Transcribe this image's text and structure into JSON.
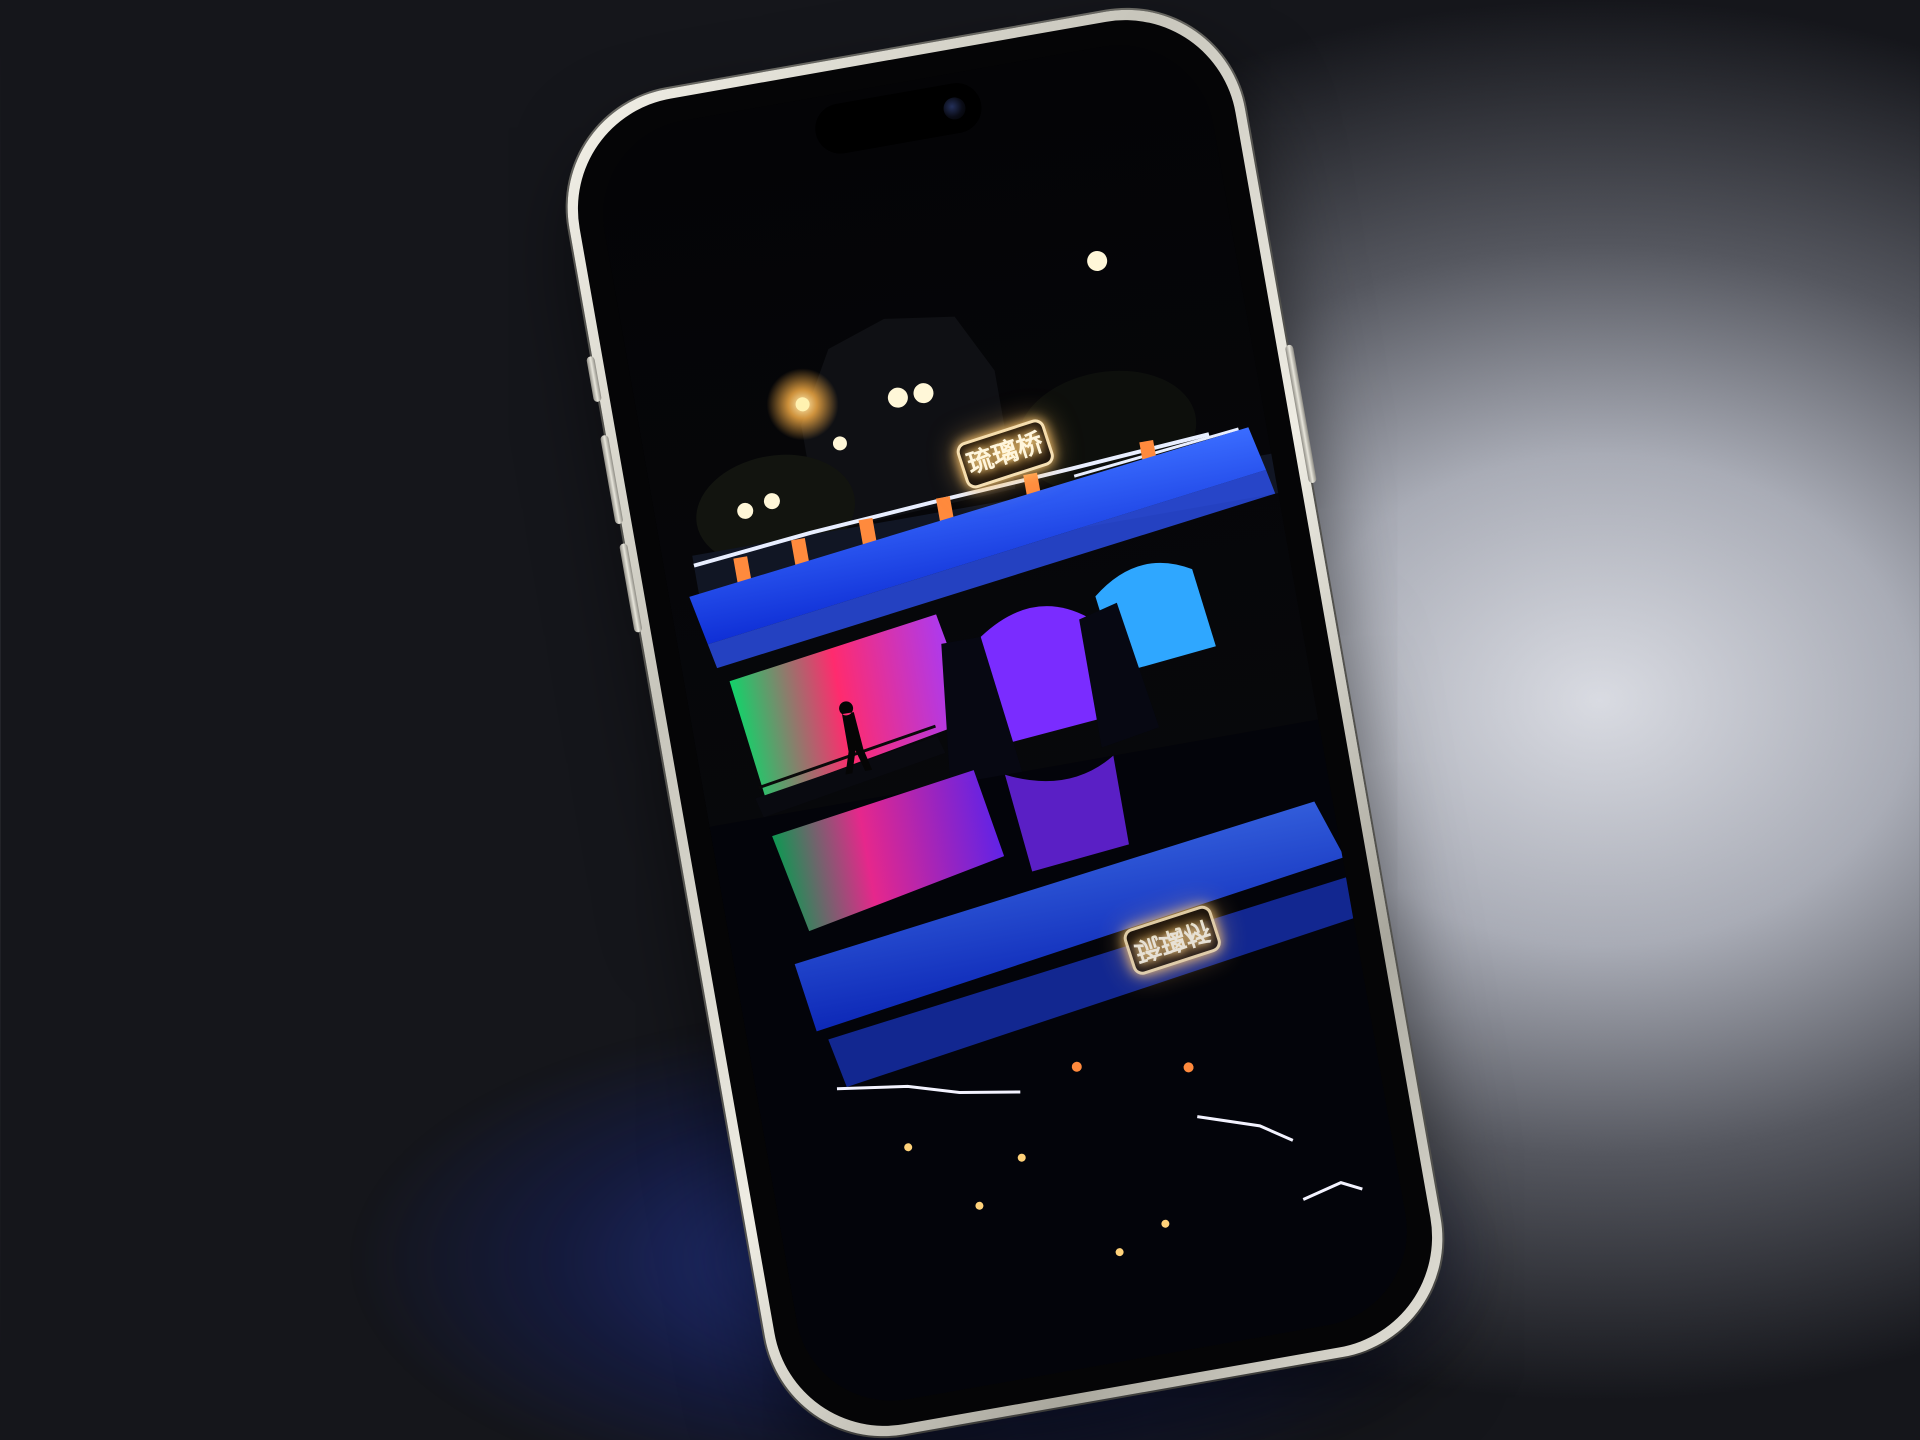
{
  "image": {
    "description_tags": [
      "smartphone",
      "night-photo",
      "illuminated-bridge",
      "reflection"
    ]
  },
  "phone": {
    "frame_color": "#e9e7de",
    "screen_photo": {
      "sign_text": "琉璃桥",
      "sign_reflection_text": "琉璃桥"
    }
  },
  "colors": {
    "bridge_blue": "#1d4dff",
    "arch_green": "#17d66b",
    "arch_pink": "#ff2d7a",
    "arch_purple": "#8a2cff",
    "lamp_orange": "#ffb347"
  }
}
